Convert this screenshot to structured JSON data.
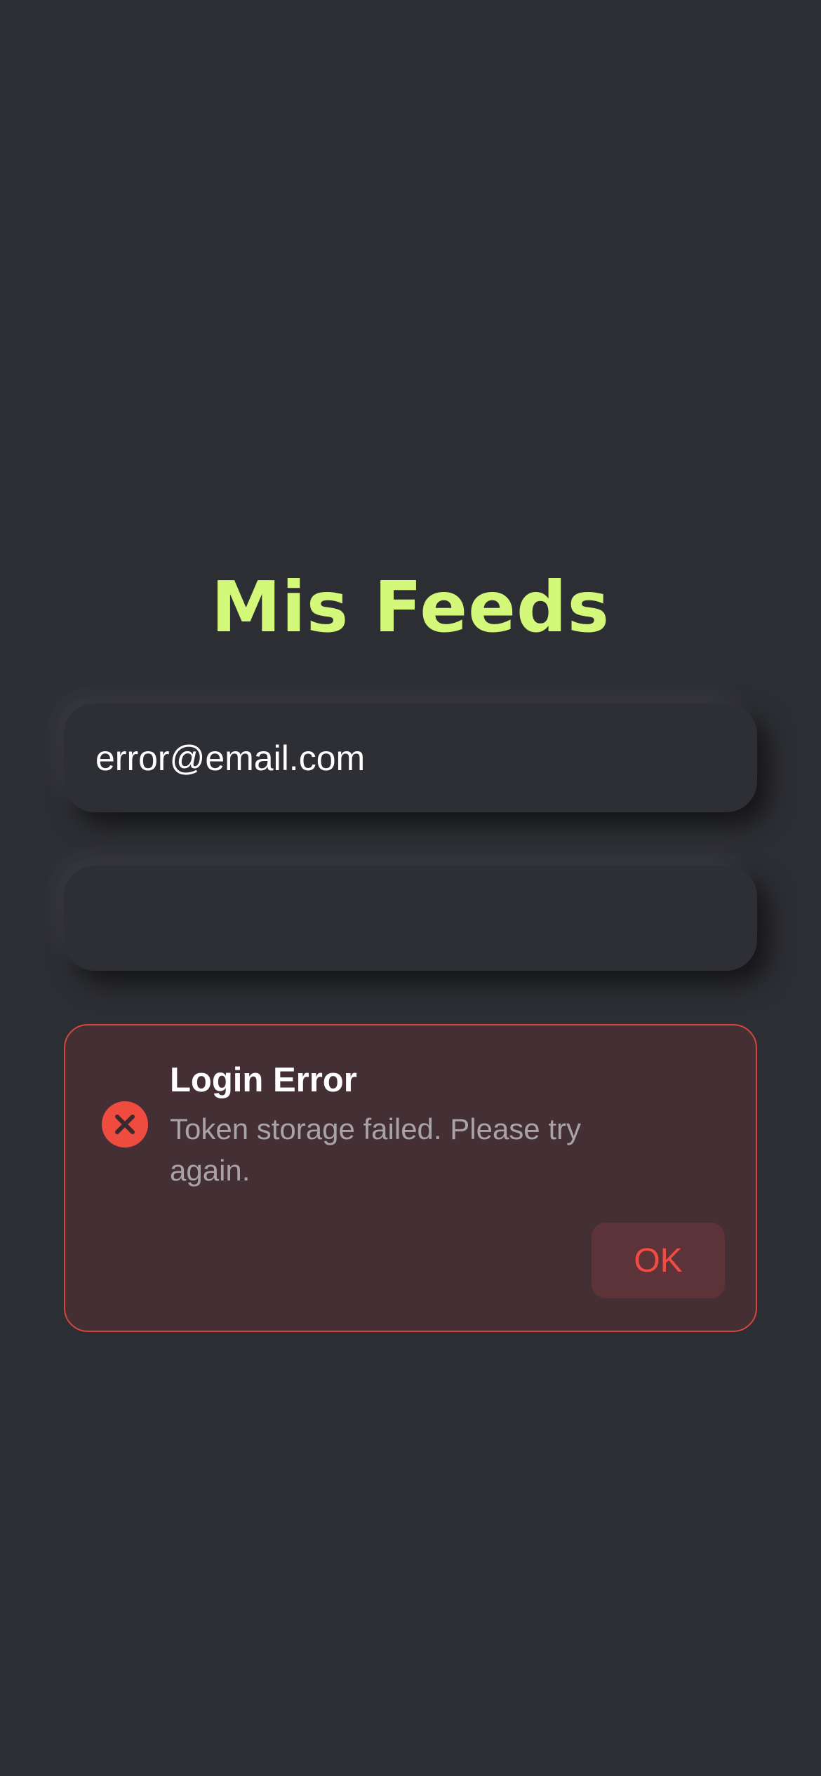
{
  "app": {
    "title": "Mis Feeds"
  },
  "login_form": {
    "email": {
      "value": "error@email.com",
      "placeholder": ""
    },
    "password": {
      "value": "",
      "placeholder": ""
    }
  },
  "error_alert": {
    "title": "Login Error",
    "message": "Token storage failed. Please try again.",
    "ok_label": "OK",
    "icon": "error-x-circle-icon"
  },
  "colors": {
    "background": "#2d2e33",
    "accent": "#d4f97a",
    "error": "#ef4b3f",
    "error_card_bg": "#442f34"
  }
}
